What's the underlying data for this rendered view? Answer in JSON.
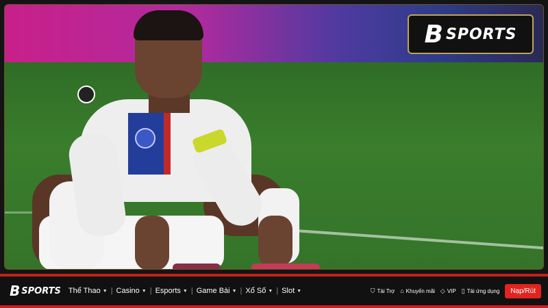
{
  "brand": {
    "logo_mark": "B",
    "logo_text": "SPORTS"
  },
  "hero": {
    "description_icon": "player-photo"
  },
  "nav": {
    "items": [
      {
        "label": "Thể Thao"
      },
      {
        "label": "Casino"
      },
      {
        "label": "Esports"
      },
      {
        "label": "Game Bài"
      },
      {
        "label": "Xổ Số"
      },
      {
        "label": "Slot"
      }
    ],
    "utilities": [
      {
        "label": "Tài Trợ",
        "icon": "shield-icon"
      },
      {
        "label": "Khuyến mãi",
        "icon": "tag-icon"
      },
      {
        "label": "VIP",
        "icon": "diamond-icon"
      },
      {
        "label": "Tải ứng dụng",
        "icon": "phone-icon"
      }
    ],
    "cta_label": "Nạp/Rút"
  },
  "colors": {
    "accent": "#c8201c",
    "cta": "#e0241f",
    "logo_border": "#bfa35a"
  }
}
